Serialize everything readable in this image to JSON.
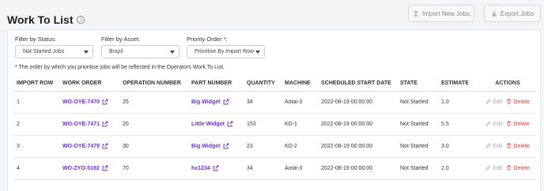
{
  "header": {
    "title": "Work To List",
    "info_icon": "info-icon",
    "import_label": "Import New Jobs",
    "export_label": "Export Jobs"
  },
  "filters": {
    "status": {
      "label": "Filter by Status:",
      "value": "Not Started Jobs"
    },
    "asset": {
      "label": "Filter by Asset:",
      "value": "Brazil"
    },
    "priority": {
      "label": "Priority Order *:",
      "value": "Prioritise By Import Row"
    }
  },
  "note": "* The order by which you prioritise jobs will be reflected in the Operators Work To List.",
  "table": {
    "columns": [
      "IMPORT ROW",
      "WORK ORDER",
      "OPERATION NUMBER",
      "PART NUMBER",
      "QUANTITY",
      "MACHINE",
      "SCHEDULED START DATE",
      "STATE",
      "ESTIMATE",
      "ACTIONS"
    ],
    "rows": [
      {
        "import_row": "1",
        "work_order": "WO-OYE-7470",
        "operation": "25",
        "part": "Big Widget",
        "quantity": "34",
        "machine": "Aotai-3",
        "start": "2022-08-19 00:00:00",
        "state": "Not Started",
        "estimate": "1.0"
      },
      {
        "import_row": "2",
        "work_order": "WO-OYE-7471",
        "operation": "20",
        "part": "Little Widget",
        "quantity": "153",
        "machine": "KD-1",
        "start": "2022-08-19 00:00:00",
        "state": "Not Started",
        "estimate": "5.5"
      },
      {
        "import_row": "3",
        "work_order": "WO-OYE-7479",
        "operation": "30",
        "part": "Big Widget",
        "quantity": "23",
        "machine": "KD-2",
        "start": "2022-08-19 00:00:00",
        "state": "Not Started",
        "estimate": "3.0"
      },
      {
        "import_row": "4",
        "work_order": "WO-ZYO-5192",
        "operation": "70",
        "part": "hx1234",
        "quantity": "34",
        "machine": "Aotai-3",
        "start": "2022-08-19 00:00:00",
        "state": "Not Started",
        "estimate": "2.0"
      }
    ],
    "edit_label": "Edit",
    "delete_label": "Delete"
  },
  "colors": {
    "link": "#6b35c9",
    "delete": "#e0453a",
    "muted": "#aaaaaa"
  }
}
